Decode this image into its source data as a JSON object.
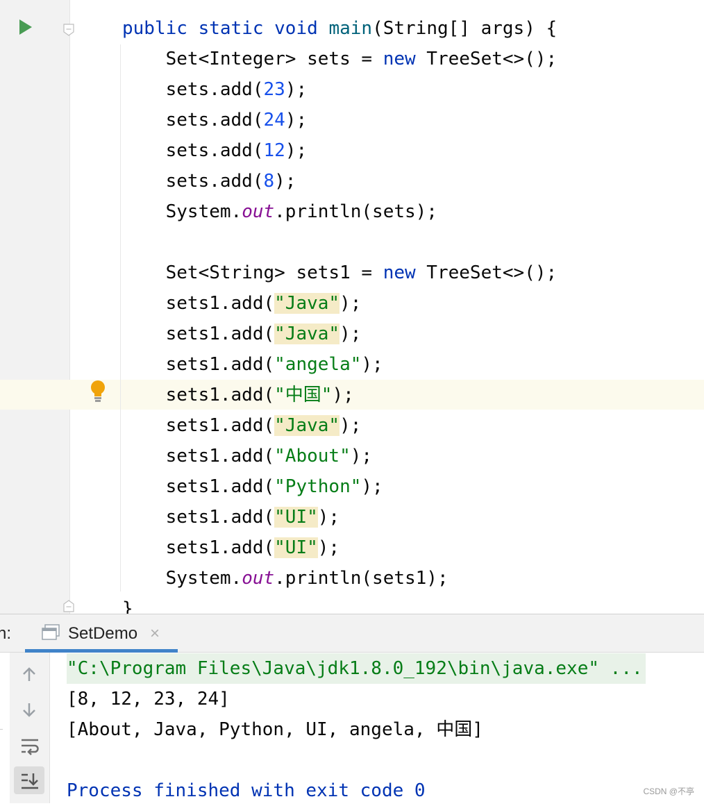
{
  "editor": {
    "lines": [
      [
        {
          "t": "public",
          "c": "kw"
        },
        {
          "t": " "
        },
        {
          "t": "static",
          "c": "kw"
        },
        {
          "t": " "
        },
        {
          "t": "void",
          "c": "kw"
        },
        {
          "t": " "
        },
        {
          "t": "main",
          "c": "fn"
        },
        {
          "t": "(String[] args) {"
        }
      ],
      [
        {
          "t": "    Set<Integer> sets = "
        },
        {
          "t": "new",
          "c": "kw"
        },
        {
          "t": " TreeSet<>();"
        }
      ],
      [
        {
          "t": "    sets.add("
        },
        {
          "t": "23",
          "c": "num"
        },
        {
          "t": ");"
        }
      ],
      [
        {
          "t": "    sets.add("
        },
        {
          "t": "24",
          "c": "num"
        },
        {
          "t": ");"
        }
      ],
      [
        {
          "t": "    sets.add("
        },
        {
          "t": "12",
          "c": "num"
        },
        {
          "t": ");"
        }
      ],
      [
        {
          "t": "    sets.add("
        },
        {
          "t": "8",
          "c": "num"
        },
        {
          "t": ");"
        }
      ],
      [
        {
          "t": "    System."
        },
        {
          "t": "out",
          "c": "fld"
        },
        {
          "t": ".println(sets);"
        }
      ],
      [
        {
          "t": ""
        }
      ],
      [
        {
          "t": "    Set<String> sets1 = "
        },
        {
          "t": "new",
          "c": "kw"
        },
        {
          "t": " TreeSet<>();"
        }
      ],
      [
        {
          "t": "    sets1.add("
        },
        {
          "t": "\"Java\"",
          "c": "str hl"
        },
        {
          "t": ");"
        }
      ],
      [
        {
          "t": "    sets1.add("
        },
        {
          "t": "\"Java\"",
          "c": "str hl"
        },
        {
          "t": ");"
        }
      ],
      [
        {
          "t": "    sets1.add("
        },
        {
          "t": "\"angela\"",
          "c": "str"
        },
        {
          "t": ");"
        }
      ],
      [
        {
          "t": "    sets1.add("
        },
        {
          "t": "\"中国\"",
          "c": "str"
        },
        {
          "t": ");"
        },
        {
          "caret": true
        }
      ],
      [
        {
          "t": "    sets1.add("
        },
        {
          "t": "\"Java\"",
          "c": "str hl"
        },
        {
          "t": ");"
        }
      ],
      [
        {
          "t": "    sets1.add("
        },
        {
          "t": "\"About\"",
          "c": "str"
        },
        {
          "t": ");"
        }
      ],
      [
        {
          "t": "    sets1.add("
        },
        {
          "t": "\"Python\"",
          "c": "str"
        },
        {
          "t": ");"
        }
      ],
      [
        {
          "t": "    sets1.add("
        },
        {
          "t": "\"UI\"",
          "c": "str hl"
        },
        {
          "t": ");"
        }
      ],
      [
        {
          "t": "    sets1.add("
        },
        {
          "t": "\"UI\"",
          "c": "str hl"
        },
        {
          "t": ");"
        }
      ],
      [
        {
          "t": "    System."
        },
        {
          "t": "out",
          "c": "fld"
        },
        {
          "t": ".println(sets1);"
        }
      ],
      [
        {
          "t": "}"
        }
      ]
    ]
  },
  "run_panel": {
    "label": "n:",
    "tab_title": "SetDemo",
    "tab_close": "×",
    "output": [
      {
        "text": "\"C:\\Program Files\\Java\\jdk1.8.0_192\\bin\\java.exe\" ...",
        "kind": "cmd"
      },
      {
        "text": "[8, 12, 23, 24]",
        "kind": "normal"
      },
      {
        "text": "[About, Java, Python, UI, angela, 中国]",
        "kind": "normal"
      },
      {
        "text": "",
        "kind": "normal"
      },
      {
        "text": "Process finished with exit code 0",
        "kind": "proc"
      }
    ]
  },
  "watermark": "CSDN @不亭",
  "icons": {
    "run": "run-main-icon",
    "bulb": "intention-bulb-icon",
    "up": "arrow-up-icon",
    "down": "arrow-down-icon",
    "wrap": "soft-wrap-icon",
    "scroll": "scroll-to-end-icon"
  },
  "colors": {
    "keyword": "#0033b3",
    "method": "#00627a",
    "number": "#1750eb",
    "string": "#067d17",
    "field": "#871094",
    "usage_highlight": "#f5ebc7",
    "tab_underline": "#4083c9"
  }
}
